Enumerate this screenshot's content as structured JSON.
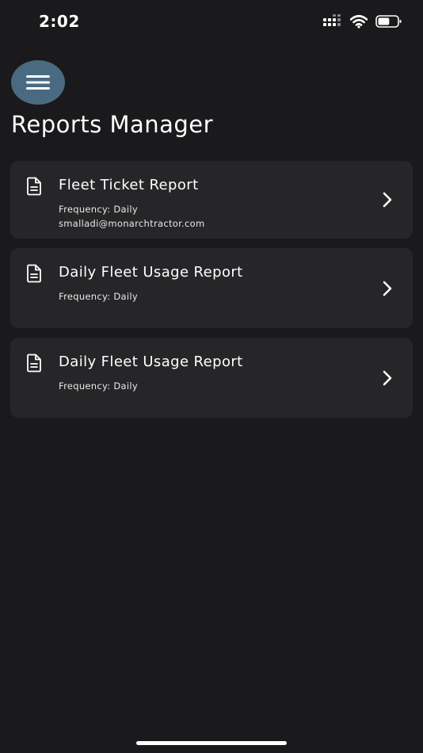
{
  "status_bar": {
    "time": "2:02",
    "icons": [
      "signal-icon",
      "wifi-icon",
      "battery-icon"
    ],
    "battery_level": 0.6
  },
  "header": {
    "menu_icon": "hamburger-menu-icon",
    "title": "Reports Manager"
  },
  "colors": {
    "background": "#1a1a1c",
    "card": "#262628",
    "menu_button": "#4a6a82",
    "text": "#ffffff"
  },
  "reports": [
    {
      "title": "Fleet Ticket Report",
      "frequency": "Frequency: Daily",
      "email": "smalladi@monarchtractor.com",
      "icon": "document-icon",
      "action_icon": "chevron-right-icon"
    },
    {
      "title": "Daily Fleet Usage Report",
      "frequency": "Frequency: Daily",
      "icon": "document-icon",
      "action_icon": "chevron-right-icon"
    },
    {
      "title": "Daily Fleet Usage Report",
      "frequency": "Frequency: Daily",
      "icon": "document-icon",
      "action_icon": "chevron-right-icon"
    }
  ]
}
